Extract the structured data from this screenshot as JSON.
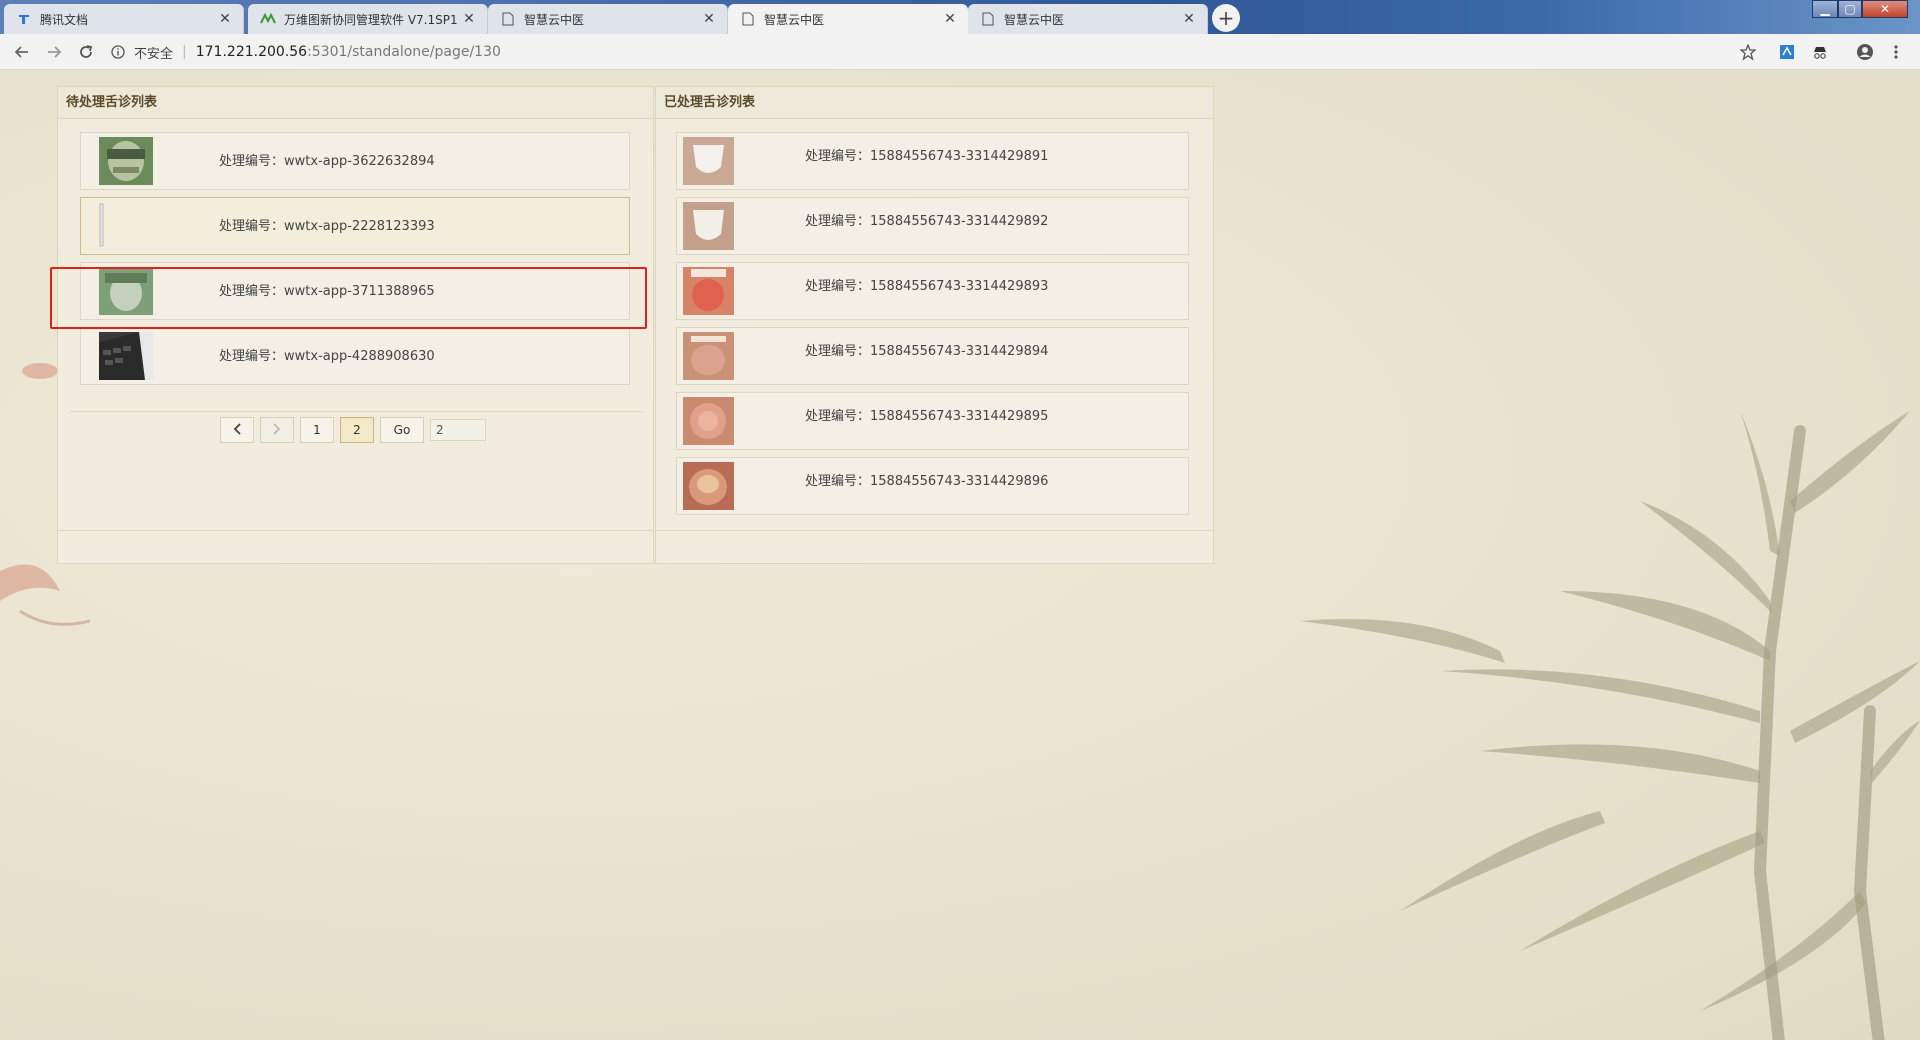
{
  "browser": {
    "tabs": [
      {
        "title": "腾讯文档",
        "favicon": "tencent-docs-icon",
        "active": false
      },
      {
        "title": "万维图新协同管理软件 V7.1SP1",
        "favicon": "app-logo-icon",
        "active": false
      },
      {
        "title": "智慧云中医",
        "favicon": "page-icon",
        "active": false
      },
      {
        "title": "智慧云中医",
        "favicon": "page-icon",
        "active": true
      },
      {
        "title": "智慧云中医",
        "favicon": "page-icon",
        "active": false
      }
    ],
    "new_tab": "+",
    "address": {
      "security_label": "不安全",
      "host": "171.221.200.56",
      "path": ":5301/standalone/page/130"
    }
  },
  "pending": {
    "title": "待处理舌诊列表",
    "items": [
      {
        "label": "处理编号：",
        "id": "wwtx-app-3622632894",
        "thumb": "face-photo"
      },
      {
        "label": "处理编号：",
        "id": "wwtx-app-2228123393",
        "thumb": "blank-photo",
        "selected": true
      },
      {
        "label": "处理编号：",
        "id": "wwtx-app-3711388965",
        "thumb": "face-photo"
      },
      {
        "label": "处理编号：",
        "id": "wwtx-app-4288908630",
        "thumb": "keyboard-photo"
      }
    ],
    "pager": {
      "prev": "‹",
      "next": "›",
      "pages": [
        "1",
        "2"
      ],
      "current": "2",
      "go_label": "Go",
      "input_value": "2"
    }
  },
  "processed": {
    "title": "已处理舌诊列表",
    "items": [
      {
        "label": "处理编号：",
        "id": "15884556743-3314429891",
        "thumb": "tongue-photo"
      },
      {
        "label": "处理编号：",
        "id": "15884556743-3314429892",
        "thumb": "tongue-photo"
      },
      {
        "label": "处理编号：",
        "id": "15884556743-3314429893",
        "thumb": "tongue-photo"
      },
      {
        "label": "处理编号：",
        "id": "15884556743-3314429894",
        "thumb": "tongue-photo"
      },
      {
        "label": "处理编号：",
        "id": "15884556743-3314429895",
        "thumb": "tongue-photo"
      },
      {
        "label": "处理编号：",
        "id": "15884556743-3314429896",
        "thumb": "tongue-photo"
      }
    ]
  },
  "colors": {
    "page_bg": "#e9e3d1",
    "panel_bg": "#f1eddf",
    "highlight": "#e0221b",
    "header_text": "#5a4a2a"
  }
}
